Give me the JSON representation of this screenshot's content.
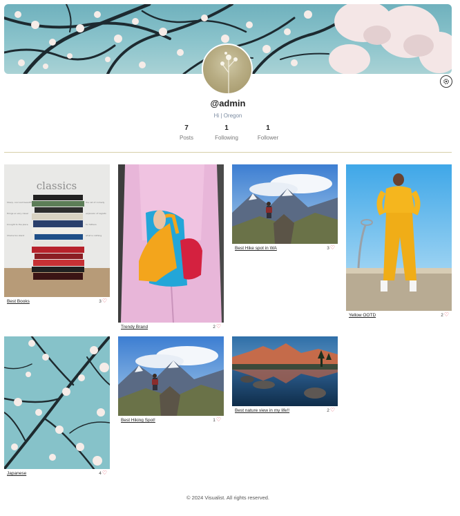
{
  "profile": {
    "username": "@admin",
    "bio": "Hi | Oregon",
    "settings_icon": "gear-icon"
  },
  "stats": [
    {
      "value": "7",
      "label": "Posts"
    },
    {
      "value": "1",
      "label": "Following"
    },
    {
      "value": "1",
      "label": "Follower"
    }
  ],
  "posts": [
    {
      "title": "Best Books",
      "likes": "3",
      "image": "books-stack"
    },
    {
      "title": "Trendy Brand",
      "likes": "2",
      "image": "pink-outfit-heels"
    },
    {
      "title": "Best Hike spot in WA",
      "likes": "3",
      "image": "mountain-hiker"
    },
    {
      "title": "Yellow OOTD",
      "likes": "2",
      "image": "yellow-tracksuit"
    },
    {
      "title": "Japanese",
      "likes": "4",
      "image": "blossom-branches"
    },
    {
      "title": "Best Hiking Spot!",
      "likes": "1",
      "image": "mountain-hiker"
    },
    {
      "title": "Best nature view in my life!!",
      "likes": "2",
      "image": "lake-reflection"
    }
  ],
  "footer": "© 2024 Visualist. All rights reserved."
}
